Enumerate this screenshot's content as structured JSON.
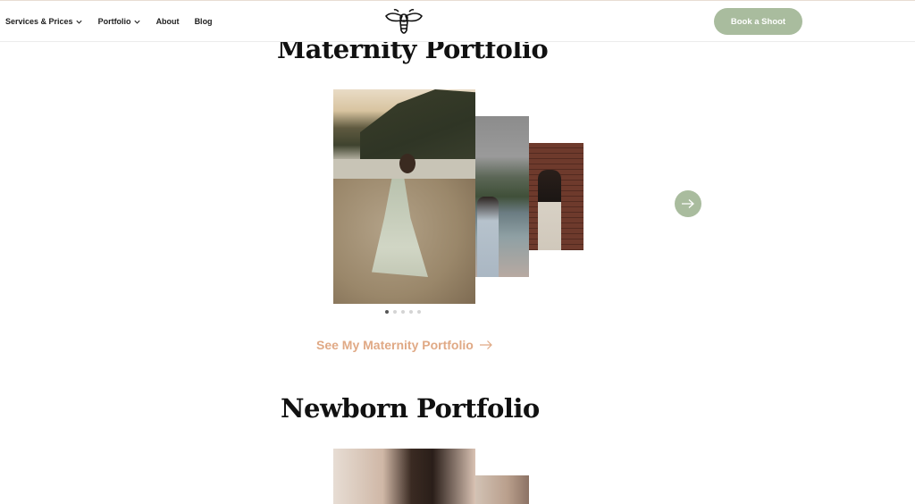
{
  "header": {
    "nav": [
      {
        "label": "Services & Prices",
        "has_dropdown": true
      },
      {
        "label": "Portfolio",
        "has_dropdown": true
      },
      {
        "label": "About",
        "has_dropdown": false
      },
      {
        "label": "Blog",
        "has_dropdown": false
      }
    ],
    "logo_icon": "bee-icon",
    "cta_label": "Book a Shoot"
  },
  "sections": {
    "maternity": {
      "title": "Maternity Portfolio",
      "link_label": "See My Maternity Portfolio",
      "dots_count": 5,
      "active_dot": 0
    },
    "newborn": {
      "title": "Newborn Portfolio"
    }
  },
  "colors": {
    "accent_green": "#a9bc9e",
    "link_peach": "#e0a985",
    "text_dark": "#111111"
  },
  "icons": {
    "next": "arrow-right-icon",
    "link_arrow": "arrow-right-icon",
    "chevron": "chevron-down-icon"
  }
}
